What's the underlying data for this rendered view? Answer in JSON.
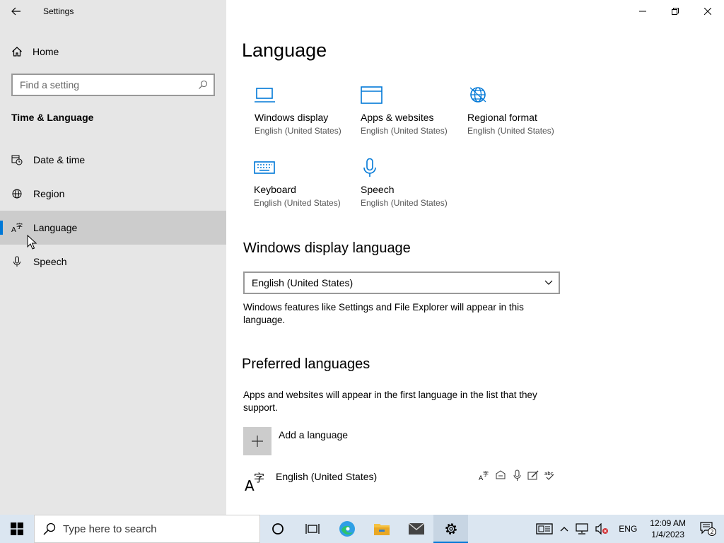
{
  "window": {
    "title": "Settings",
    "back_label": "Back",
    "controls": [
      "Minimize",
      "Restore",
      "Close"
    ]
  },
  "sidebar": {
    "home_label": "Home",
    "search_placeholder": "Find a setting",
    "section_title": "Time & Language",
    "items": [
      {
        "label": "Date & time",
        "icon": "calendar-clock-icon"
      },
      {
        "label": "Region",
        "icon": "globe-icon"
      },
      {
        "label": "Language",
        "icon": "language-icon",
        "active": true
      },
      {
        "label": "Speech",
        "icon": "microphone-icon"
      }
    ]
  },
  "main": {
    "title": "Language",
    "tiles": [
      {
        "label": "Windows display",
        "sub": "English (United States)",
        "icon": "monitor-icon"
      },
      {
        "label": "Apps & websites",
        "sub": "English (United States)",
        "icon": "browser-window-icon"
      },
      {
        "label": "Regional format",
        "sub": "English (United States)",
        "icon": "globe-icon"
      },
      {
        "label": "Keyboard",
        "sub": "English (United States)",
        "icon": "keyboard-icon"
      },
      {
        "label": "Speech",
        "sub": "English (United States)",
        "icon": "microphone-icon"
      }
    ],
    "display_language": {
      "heading": "Windows display language",
      "selected": "English (United States)",
      "description": "Windows features like Settings and File Explorer will appear in this language."
    },
    "preferred": {
      "heading": "Preferred languages",
      "description": "Apps and websites will appear in the first language in the list that they support.",
      "add_label": "Add a language",
      "languages": [
        {
          "name": "English (United States)"
        }
      ]
    }
  },
  "taskbar": {
    "search_placeholder": "Type here to search",
    "apps": [
      "cortana-icon",
      "task-view-icon",
      "edge-icon",
      "file-explorer-icon",
      "mail-icon",
      "settings-icon"
    ],
    "tray": {
      "language": "ENG",
      "time": "12:09 AM",
      "date": "1/4/2023",
      "notification_count": "2"
    }
  },
  "colors": {
    "accent": "#0078d7",
    "sidebar_bg": "#e6e6e6",
    "taskbar_bg": "#dbe6f1"
  }
}
